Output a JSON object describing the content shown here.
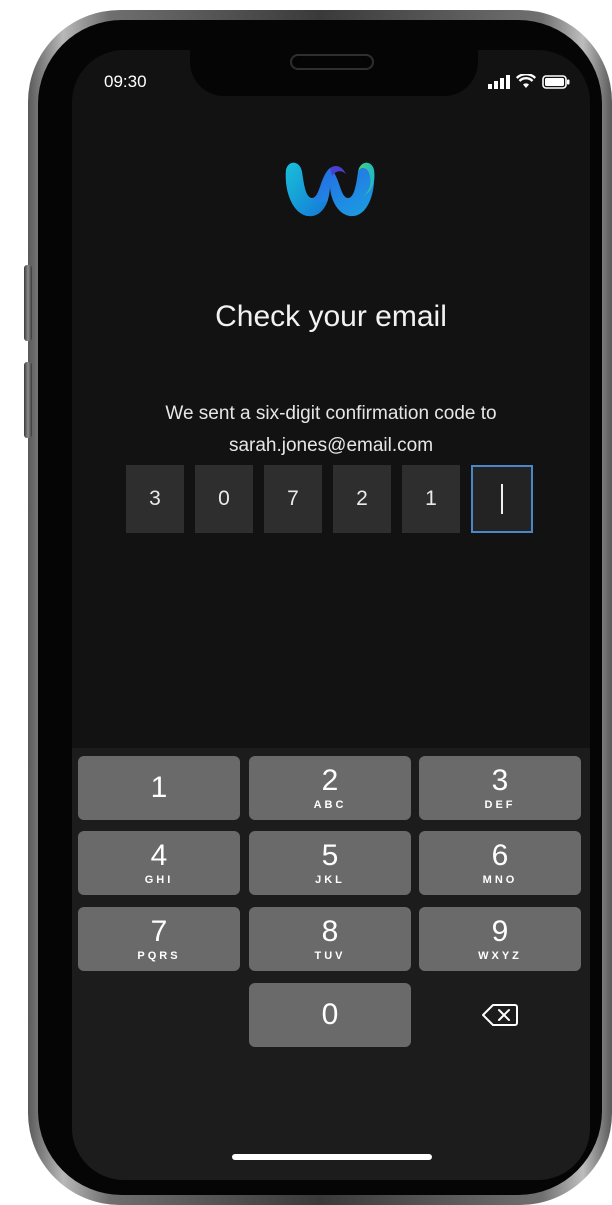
{
  "status_bar": {
    "time": "09:30"
  },
  "screen": {
    "title": "Check your email",
    "subtitle_line1": "We sent a six-digit confirmation code to",
    "subtitle_line2": "sarah.jones@email.com"
  },
  "code_digits": [
    "3",
    "0",
    "7",
    "2",
    "1",
    ""
  ],
  "keypad": {
    "k1": {
      "num": "1",
      "letters": ""
    },
    "k2": {
      "num": "2",
      "letters": "ABC"
    },
    "k3": {
      "num": "3",
      "letters": "DEF"
    },
    "k4": {
      "num": "4",
      "letters": "GHI"
    },
    "k5": {
      "num": "5",
      "letters": "JKL"
    },
    "k6": {
      "num": "6",
      "letters": "MNO"
    },
    "k7": {
      "num": "7",
      "letters": "PQRS"
    },
    "k8": {
      "num": "8",
      "letters": "TUV"
    },
    "k9": {
      "num": "9",
      "letters": "WXYZ"
    },
    "k0": {
      "num": "0",
      "letters": ""
    }
  },
  "icons": {
    "logo": "webex-logo-icon",
    "signal": "cellular-signal-icon",
    "wifi": "wifi-icon",
    "battery": "battery-icon",
    "delete": "backspace-icon"
  },
  "colors": {
    "background": "#121212",
    "code_box": "#2e2e2e",
    "active_border": "#4a86c8",
    "key": "#6a6a6a"
  }
}
